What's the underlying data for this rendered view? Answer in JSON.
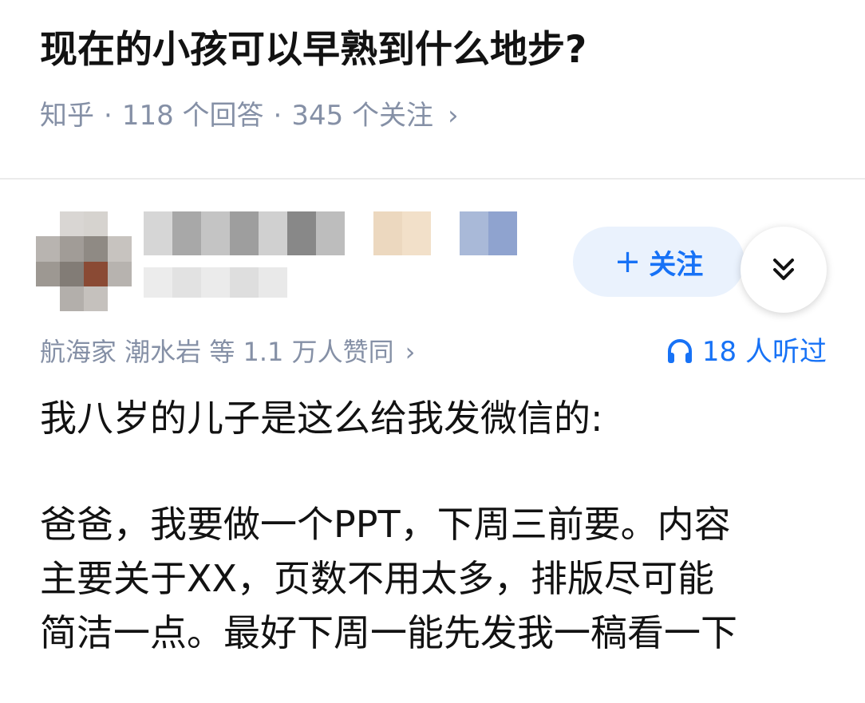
{
  "question": {
    "title": "现在的小孩可以早熟到什么地步?",
    "source": "知乎",
    "separator": "·",
    "answers": "118 个回答",
    "followers": "345 个关注",
    "more_glyph": "›"
  },
  "author": {
    "follow_label": "关注",
    "follow_plus": "+",
    "expand_icon": "double-chevron-down-icon"
  },
  "answer": {
    "upvoters": "航海家 潮水岩 等 1.1 万人赞同",
    "upvoters_chevron": "›",
    "listen_count": "18 人听过",
    "listen_icon": "headphones-icon",
    "paragraph1": "我八岁的儿子是这么给我发微信的:",
    "paragraph2_line1": "爸爸，我要做一个PPT，下周三前要。内容",
    "paragraph2_line2": "主要关于XX，页数不用太多，排版尽可能",
    "paragraph2_line3": "简洁一点。最好下周一能先发我一稿看一下"
  },
  "colors": {
    "title_text": "#121212",
    "meta_text": "#8590a6",
    "accent_blue": "#1772f6",
    "follow_bg": "#eaf2fd",
    "divider": "#ebebeb"
  }
}
